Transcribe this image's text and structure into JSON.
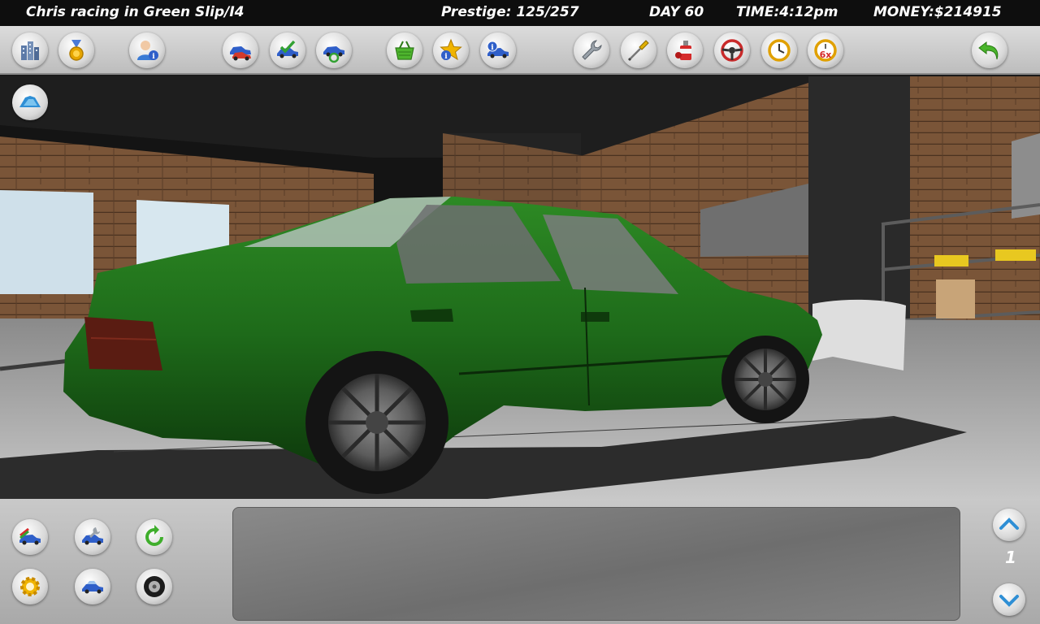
{
  "status": {
    "player_car": "Chris racing in Green Slip/I4",
    "prestige": "Prestige: 125/257",
    "day": "DAY 60",
    "time": "TIME:4:12pm",
    "money": "MONEY:$214915"
  },
  "toolbar": {
    "icons": [
      "city-icon",
      "medal-icon",
      "profile-icon",
      "car-list-icon",
      "car-check-icon",
      "car-swap-icon",
      "shop-basket-icon",
      "favorite-info-icon",
      "car-info-icon",
      "wrench-icon",
      "screwdriver-icon",
      "paint-can-icon",
      "steering-wheel-icon",
      "clock-icon",
      "time-6x-icon",
      "back-arrow-icon"
    ],
    "speed_label": "6x"
  },
  "scene": {
    "car_color": "#1e6b1a",
    "view_button_icon": "camera-view-icon"
  },
  "bottom": {
    "icons": [
      "car-paint-icon",
      "car-parts-icon",
      "refresh-icon",
      "settings-gear-icon",
      "car-blue-icon",
      "tire-icon"
    ],
    "page_number": "1",
    "scroll_up_icon": "chevron-up-icon",
    "scroll_down_icon": "chevron-down-icon"
  },
  "colors": {
    "accent_blue": "#2f5fc9",
    "accent_gold": "#f0b400",
    "accent_green": "#33a133",
    "hud_background": "#0e0e0e"
  }
}
